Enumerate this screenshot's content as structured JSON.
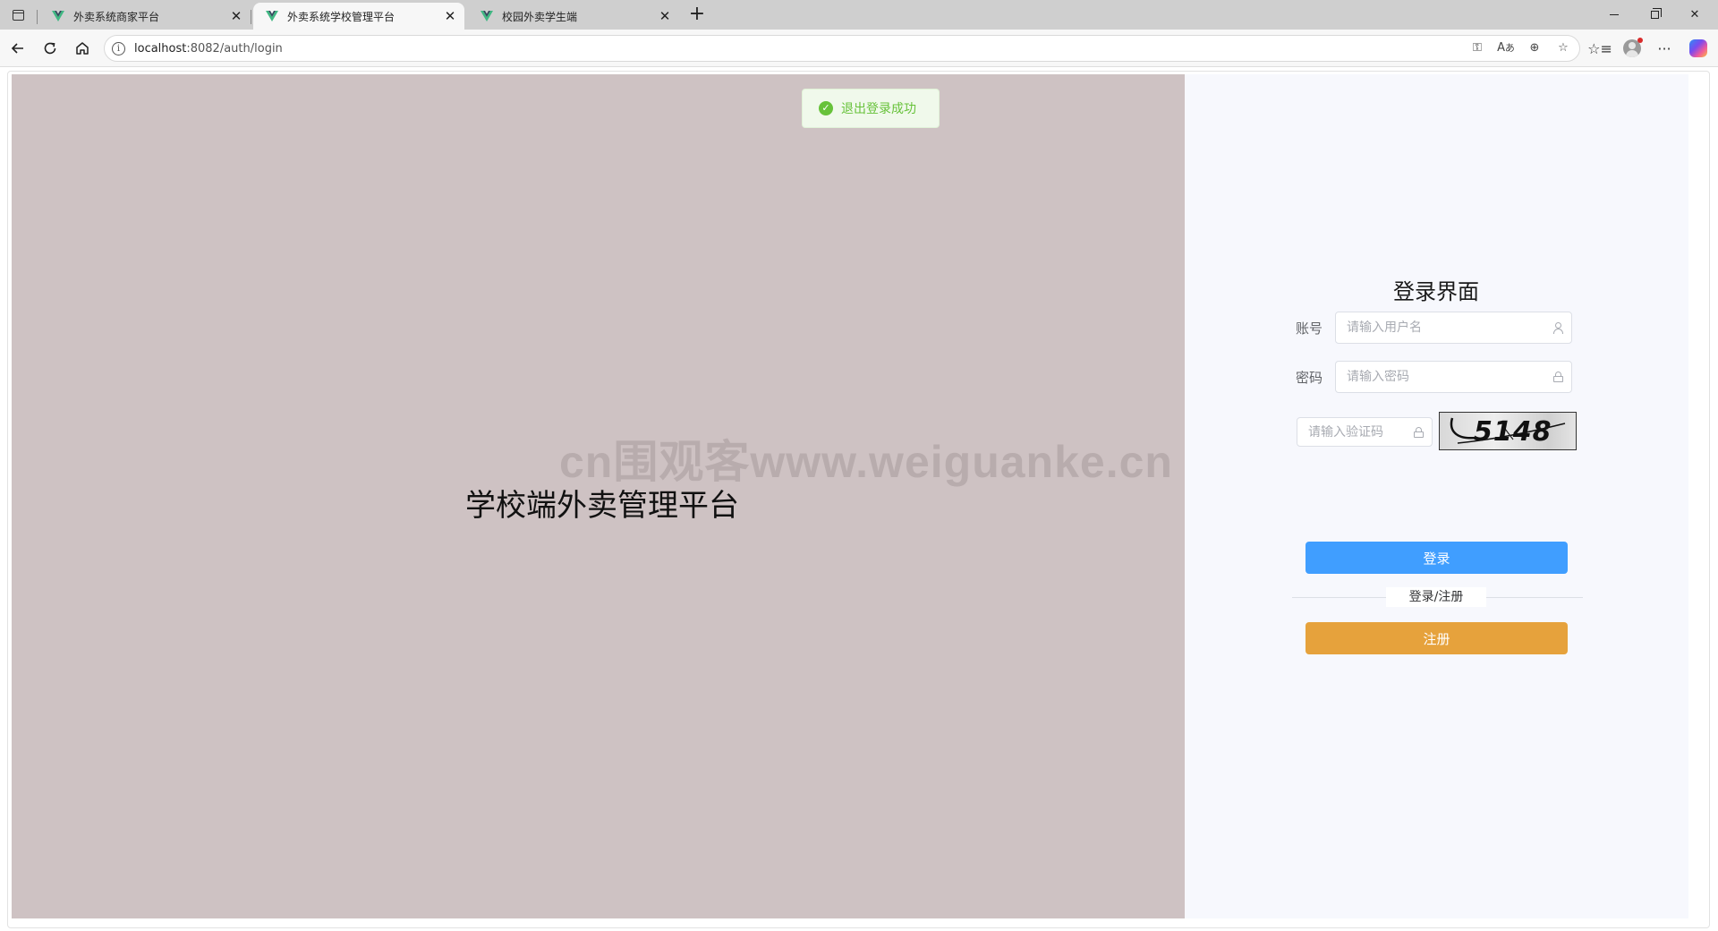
{
  "browser": {
    "tabs": [
      {
        "title": "外卖系统商家平台",
        "active": false
      },
      {
        "title": "外卖系统学校管理平台",
        "active": true
      },
      {
        "title": "校园外卖学生端",
        "active": false
      }
    ],
    "url_host": "localhost",
    "url_path": ":8082/auth/login",
    "icons": {
      "tab_menu": "tab-actions-icon",
      "favicon": "vue-logo-icon",
      "close": "close-icon",
      "new_tab": "plus-icon",
      "back": "arrow-left-icon",
      "reload": "reload-icon",
      "home": "home-icon",
      "site_info": "info-icon",
      "password_key": "key-icon",
      "read_aloud": "read-aloud-icon",
      "zoom": "zoom-in-icon",
      "favorite": "star-icon",
      "favorites": "favorites-icon",
      "profile": "profile-avatar",
      "more": "ellipsis-icon",
      "copilot": "copilot-icon"
    }
  },
  "toast": {
    "message": "退出登录成功",
    "color": "#67c23a"
  },
  "left": {
    "title": "学校端外卖管理平台",
    "background": "#cec2c3"
  },
  "watermark": "cn围观客www.weiguanke.cn",
  "login": {
    "title": "登录界面",
    "account_label": "账号",
    "account_placeholder": "请输入用户名",
    "password_label": "密码",
    "password_placeholder": "请输入密码",
    "captcha_placeholder": "请输入验证码",
    "captcha_code": "5148",
    "login_button": "登录",
    "divider_text": "登录/注册",
    "register_button": "注册",
    "colors": {
      "login_button": "#409eff",
      "register_button": "#e6a23c"
    }
  }
}
